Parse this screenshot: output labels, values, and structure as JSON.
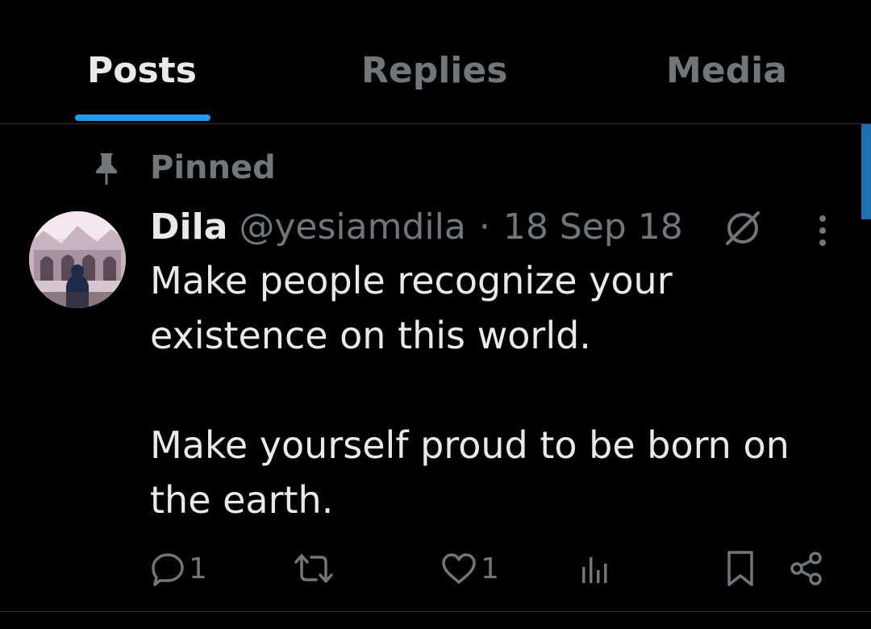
{
  "tabs": [
    {
      "label": "Posts",
      "active": true
    },
    {
      "label": "Replies",
      "active": false
    },
    {
      "label": "Media",
      "active": false
    }
  ],
  "colors": {
    "accent": "#1d9bf0",
    "background": "#000000",
    "muted": "#71767b",
    "text": "#e7e9ea"
  },
  "post": {
    "pinned_label": "Pinned",
    "author_name": "Dila",
    "handle": "@yesiamdila",
    "separator": "·",
    "date": "18 Sep 18",
    "text_line1": "Make people recognize your existence on this world.",
    "text_line2": "Make yourself proud to be born on the earth.",
    "reply_count": "1",
    "like_count": "1",
    "icons": [
      "pin-icon",
      "avatar",
      "blocked-icon",
      "more-icon",
      "reply-icon",
      "repost-icon",
      "like-icon",
      "views-icon",
      "bookmark-icon",
      "share-icon"
    ]
  }
}
